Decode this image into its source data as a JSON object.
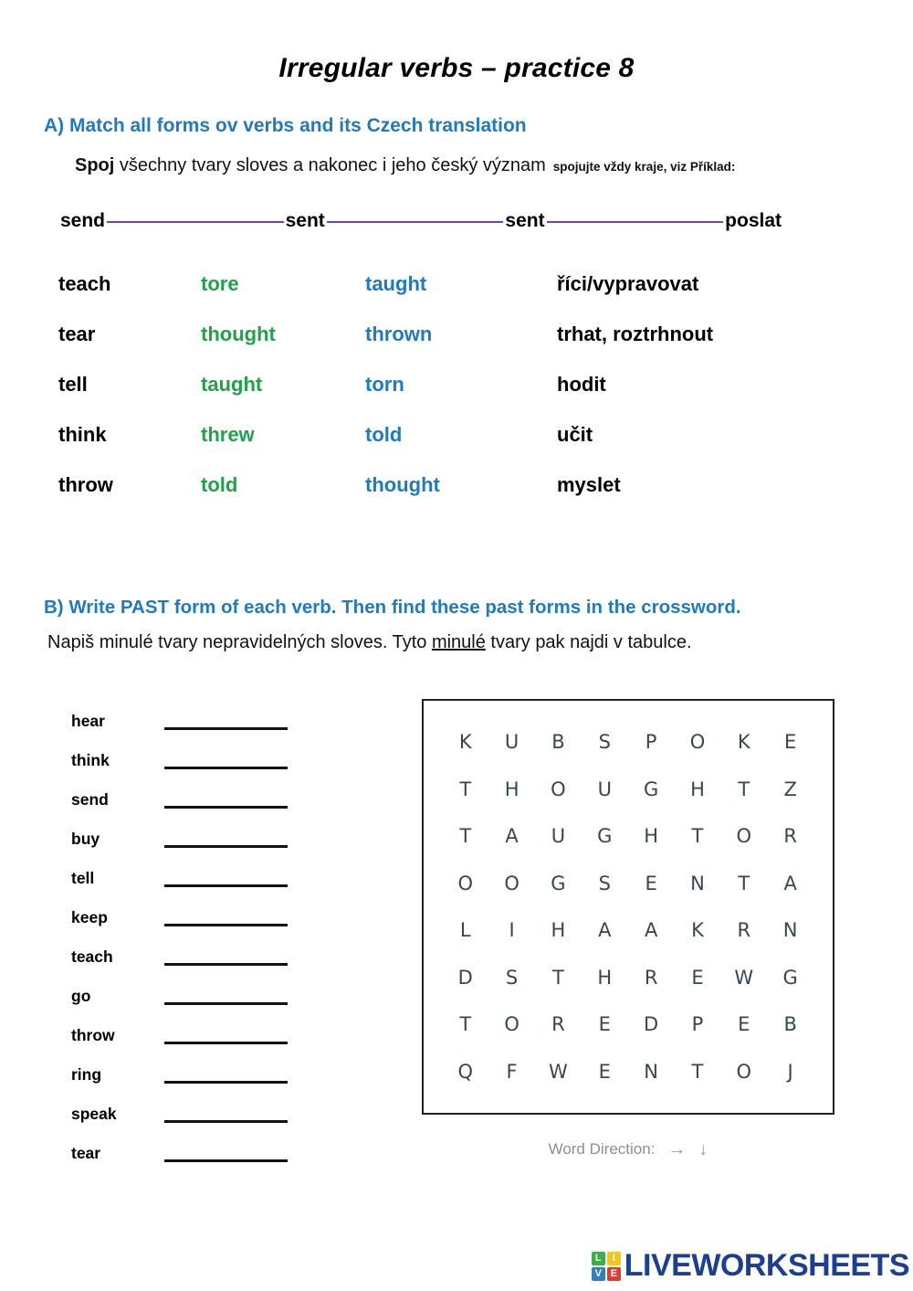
{
  "title": "Irregular verbs – practice 8",
  "section_a": {
    "heading": "A)  Match all forms ov verbs and its Czech translation",
    "sub_bold": "Spoj",
    "sub_rest": " všechny tvary sloves a nakonec i jeho český význam",
    "sub_note": "spojujte vždy kraje, viz Příklad:",
    "example": {
      "base": "send",
      "past": "sent",
      "participle": "sent",
      "czech": "poslat",
      "line_color": "#7b3f9d"
    },
    "columns": {
      "base_color": "#000000",
      "past_color": "#22a04a",
      "participle_color": "#2179c0",
      "czech_color": "#000000"
    },
    "rows": [
      {
        "base": "teach",
        "past": "tore",
        "participle": "taught",
        "czech": "říci/vypravovat"
      },
      {
        "base": "tear",
        "past": "thought",
        "participle": "thrown",
        "czech": "trhat, roztrhnout"
      },
      {
        "base": "tell",
        "past": "taught",
        "participle": "torn",
        "czech": "hodit"
      },
      {
        "base": "think",
        "past": "threw",
        "participle": "told",
        "czech": "učit"
      },
      {
        "base": "throw",
        "past": "told",
        "participle": "thought",
        "czech": "myslet"
      }
    ]
  },
  "section_b": {
    "heading": "B)  Write PAST form of each verb. Then find these past forms in the crossword.",
    "sub_1": "Napiš minulé tvary nepravidelných sloves. Tyto ",
    "sub_underlined": "minulé",
    "sub_2": " tvary pak najdi v tabulce.",
    "verbs": [
      {
        "label": "hear",
        "answer": ""
      },
      {
        "label": "think",
        "answer": ""
      },
      {
        "label": "send",
        "answer": ""
      },
      {
        "label": "buy",
        "answer": ""
      },
      {
        "label": "tell",
        "answer": ""
      },
      {
        "label": "keep",
        "answer": ""
      },
      {
        "label": "teach",
        "answer": ""
      },
      {
        "label": "go",
        "answer": ""
      },
      {
        "label": "throw",
        "answer": ""
      },
      {
        "label": "ring",
        "answer": ""
      },
      {
        "label": "speak",
        "answer": ""
      },
      {
        "label": "tear",
        "answer": ""
      }
    ],
    "wordsearch": {
      "rows": 8,
      "cols": 8,
      "letter_color": "#37474f",
      "grid": [
        [
          "K",
          "U",
          "B",
          "S",
          "P",
          "O",
          "K",
          "E"
        ],
        [
          "T",
          "H",
          "O",
          "U",
          "G",
          "H",
          "T",
          "Z"
        ],
        [
          "T",
          "A",
          "U",
          "G",
          "H",
          "T",
          "O",
          "R"
        ],
        [
          "O",
          "O",
          "G",
          "S",
          "E",
          "N",
          "T",
          "A"
        ],
        [
          "L",
          "I",
          "H",
          "A",
          "A",
          "K",
          "R",
          "N"
        ],
        [
          "D",
          "S",
          "T",
          "H",
          "R",
          "E",
          "W",
          "G"
        ],
        [
          "T",
          "O",
          "R",
          "E",
          "D",
          "P",
          "E",
          "B"
        ],
        [
          "Q",
          "F",
          "W",
          "E",
          "N",
          "T",
          "O",
          "J"
        ]
      ],
      "direction_label": "Word Direction:",
      "direction_icons": [
        "→",
        "↓"
      ]
    }
  },
  "footer": {
    "logo_tiles": [
      "L",
      "I",
      "V",
      "E"
    ],
    "logo_word": "LIVEWORKSHEETS",
    "logo_color": "#1c3f94"
  }
}
